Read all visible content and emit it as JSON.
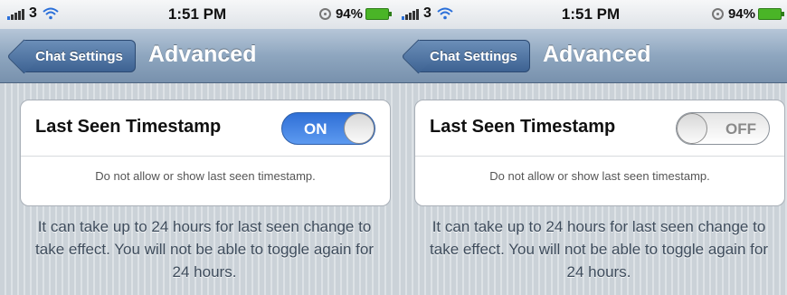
{
  "screens": [
    {
      "status": {
        "carrier": "3",
        "time": "1:51 PM",
        "battery": "94%"
      },
      "nav": {
        "back_label": "Chat Settings",
        "title": "Advanced"
      },
      "setting": {
        "label": "Last Seen Timestamp",
        "toggle_text": "ON",
        "state": "on",
        "note": "Do not allow or show last seen timestamp."
      },
      "footer": "It can take up to 24 hours for last seen change to take effect. You will not be able to toggle again for 24 hours."
    },
    {
      "status": {
        "carrier": "3",
        "time": "1:51 PM",
        "battery": "94%"
      },
      "nav": {
        "back_label": "Chat Settings",
        "title": "Advanced"
      },
      "setting": {
        "label": "Last Seen Timestamp",
        "toggle_text": "OFF",
        "state": "off",
        "note": "Do not allow or show last seen timestamp."
      },
      "footer": "It can take up to 24 hours for last seen change to take effect. You will not be able to toggle again for 24 hours."
    }
  ],
  "colors": {
    "accent": "#2f6fd6",
    "nav_bar": "#8ea6bf",
    "background": "#cbd2d8"
  },
  "icons": [
    "signal-icon",
    "wifi-icon",
    "lock-icon",
    "battery-icon"
  ]
}
